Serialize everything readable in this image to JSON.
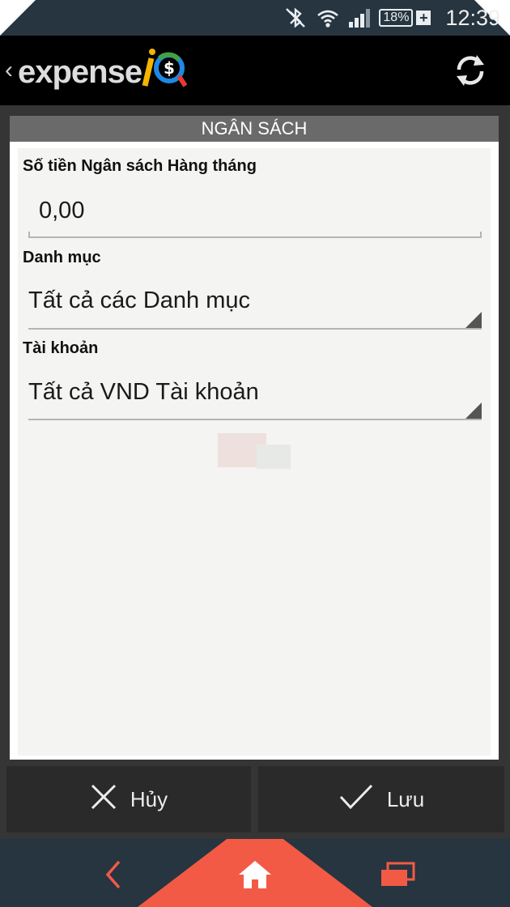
{
  "status_bar": {
    "battery_percent": "18%",
    "time": "12:39"
  },
  "app_bar": {
    "logo_text": "expense",
    "logo_mark": "iQ",
    "back_icon": "chevron-left-icon",
    "refresh_icon": "refresh-icon"
  },
  "section": {
    "title": "NGÂN SÁCH"
  },
  "form": {
    "amount_label": "Số tiền Ngân sách Hàng tháng",
    "amount_value": "0,00",
    "category_label": "Danh mục",
    "category_value": "Tất cả các Danh mục",
    "account_label": "Tài khoản",
    "account_value": "Tất cả VND Tài khoản"
  },
  "actions": {
    "cancel_label": "Hủy",
    "save_label": "Lưu"
  },
  "nav": {
    "back_icon": "back-arrow-icon",
    "home_icon": "home-icon",
    "recents_icon": "recent-apps-icon"
  },
  "colors": {
    "status_bar": "#263540",
    "action_bar": "#000000",
    "header": "#6a6a6a",
    "accent": "#f25a45",
    "button_bg": "#2a2a2a"
  }
}
